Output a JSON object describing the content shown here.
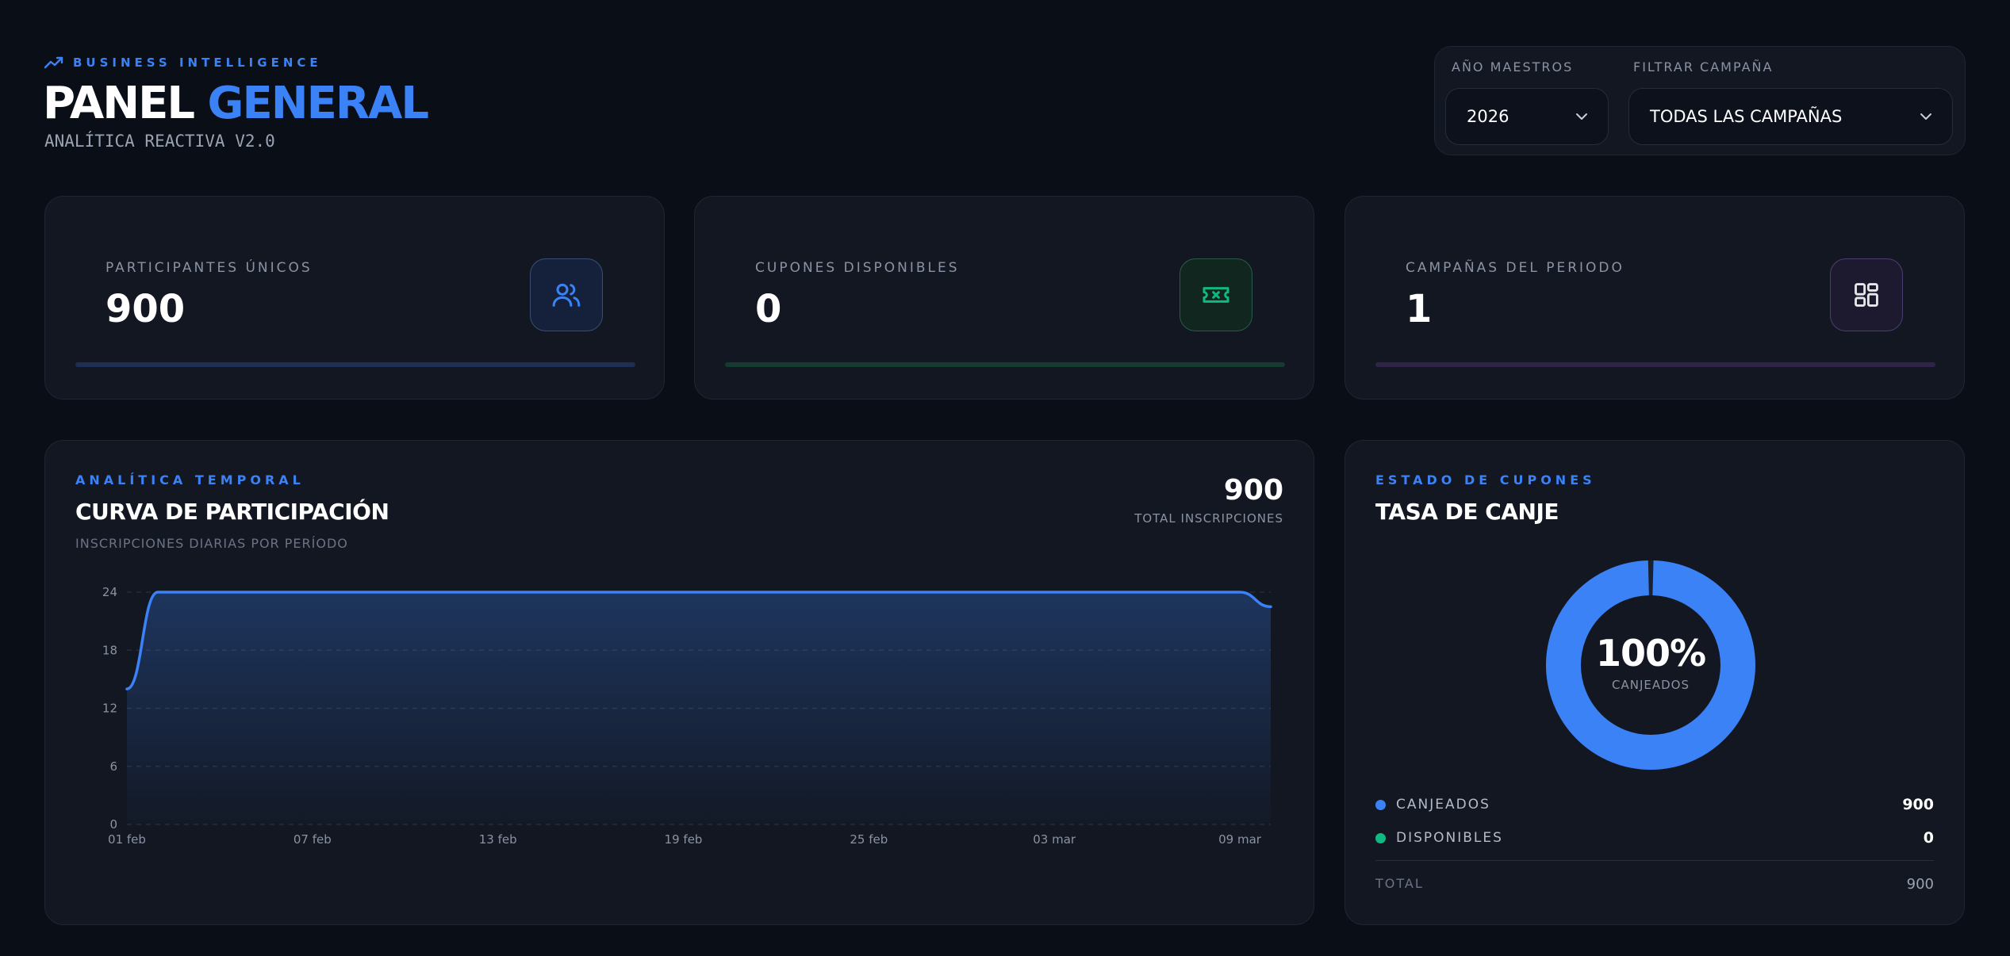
{
  "header": {
    "eyebrow": "BUSINESS INTELLIGENCE",
    "eyebrow_icon": "trending-up-icon",
    "title_main": "PANEL",
    "title_accent": "GENERAL",
    "subtitle": "ANALÍTICA REACTIVA V2.0"
  },
  "filters": {
    "year_label": "AÑO MAESTROS",
    "year_value": "2026",
    "campaign_label": "FILTRAR CAMPAÑA",
    "campaign_value": "TODAS LAS CAMPAÑAS"
  },
  "kpis": [
    {
      "label": "PARTICIPANTES ÚNICOS",
      "value": "900",
      "icon": "users-icon",
      "color": "#3b82f6"
    },
    {
      "label": "CUPONES DISPONIBLES",
      "value": "0",
      "icon": "ticket-icon",
      "color": "#10b981"
    },
    {
      "label": "CAMPAÑAS DEL PERIODO",
      "value": "1",
      "icon": "grid-icon",
      "color": "#8b5cf6"
    }
  ],
  "participation": {
    "eyebrow": "ANALÍTICA TEMPORAL",
    "title": "CURVA DE PARTICIPACIÓN",
    "subtitle": "INSCRIPCIONES DIARIAS POR PERÍODO",
    "total_value": "900",
    "total_label": "TOTAL INSCRIPCIONES"
  },
  "coupons": {
    "eyebrow": "ESTADO DE CUPONES",
    "title": "TASA DE CANJE",
    "center_value": "100%",
    "center_label": "CANJEADOS",
    "legend": [
      {
        "label": "CANJEADOS",
        "value": "900",
        "color": "#3b82f6"
      },
      {
        "label": "DISPONIBLES",
        "value": "0",
        "color": "#10b981"
      }
    ],
    "total_label": "TOTAL",
    "total_value": "900"
  },
  "chart_data": [
    {
      "type": "area",
      "x_ticks": [
        "01 feb",
        "07 feb",
        "13 feb",
        "19 feb",
        "25 feb",
        "03 mar",
        "09 mar"
      ],
      "y_ticks": [
        0,
        6,
        12,
        18,
        24
      ],
      "ylim": [
        0,
        24
      ],
      "x": [
        "01 feb",
        "02 feb",
        "03 feb",
        "04 feb",
        "05 feb",
        "06 feb",
        "07 feb",
        "08 feb",
        "09 feb",
        "10 feb",
        "11 feb",
        "12 feb",
        "13 feb",
        "14 feb",
        "15 feb",
        "16 feb",
        "17 feb",
        "18 feb",
        "19 feb",
        "20 feb",
        "21 feb",
        "22 feb",
        "23 feb",
        "24 feb",
        "25 feb",
        "26 feb",
        "27 feb",
        "28 feb",
        "01 mar",
        "02 mar",
        "03 mar",
        "04 mar",
        "05 mar",
        "06 mar",
        "07 mar",
        "08 mar",
        "09 mar",
        "10 mar"
      ],
      "values": [
        14,
        24,
        24,
        24,
        24,
        24,
        24,
        24,
        24,
        24,
        24,
        24,
        24,
        24,
        24,
        24,
        24,
        24,
        24,
        24,
        24,
        24,
        24,
        24,
        24,
        24,
        24,
        24,
        24,
        24,
        24,
        24,
        24,
        24,
        24,
        24,
        24,
        22.5
      ],
      "color": "#3b82f6",
      "grid": true
    },
    {
      "type": "pie",
      "categories": [
        "CANJEADOS",
        "DISPONIBLES"
      ],
      "values": [
        900,
        0
      ],
      "colors": [
        "#3b82f6",
        "#10b981"
      ]
    }
  ]
}
